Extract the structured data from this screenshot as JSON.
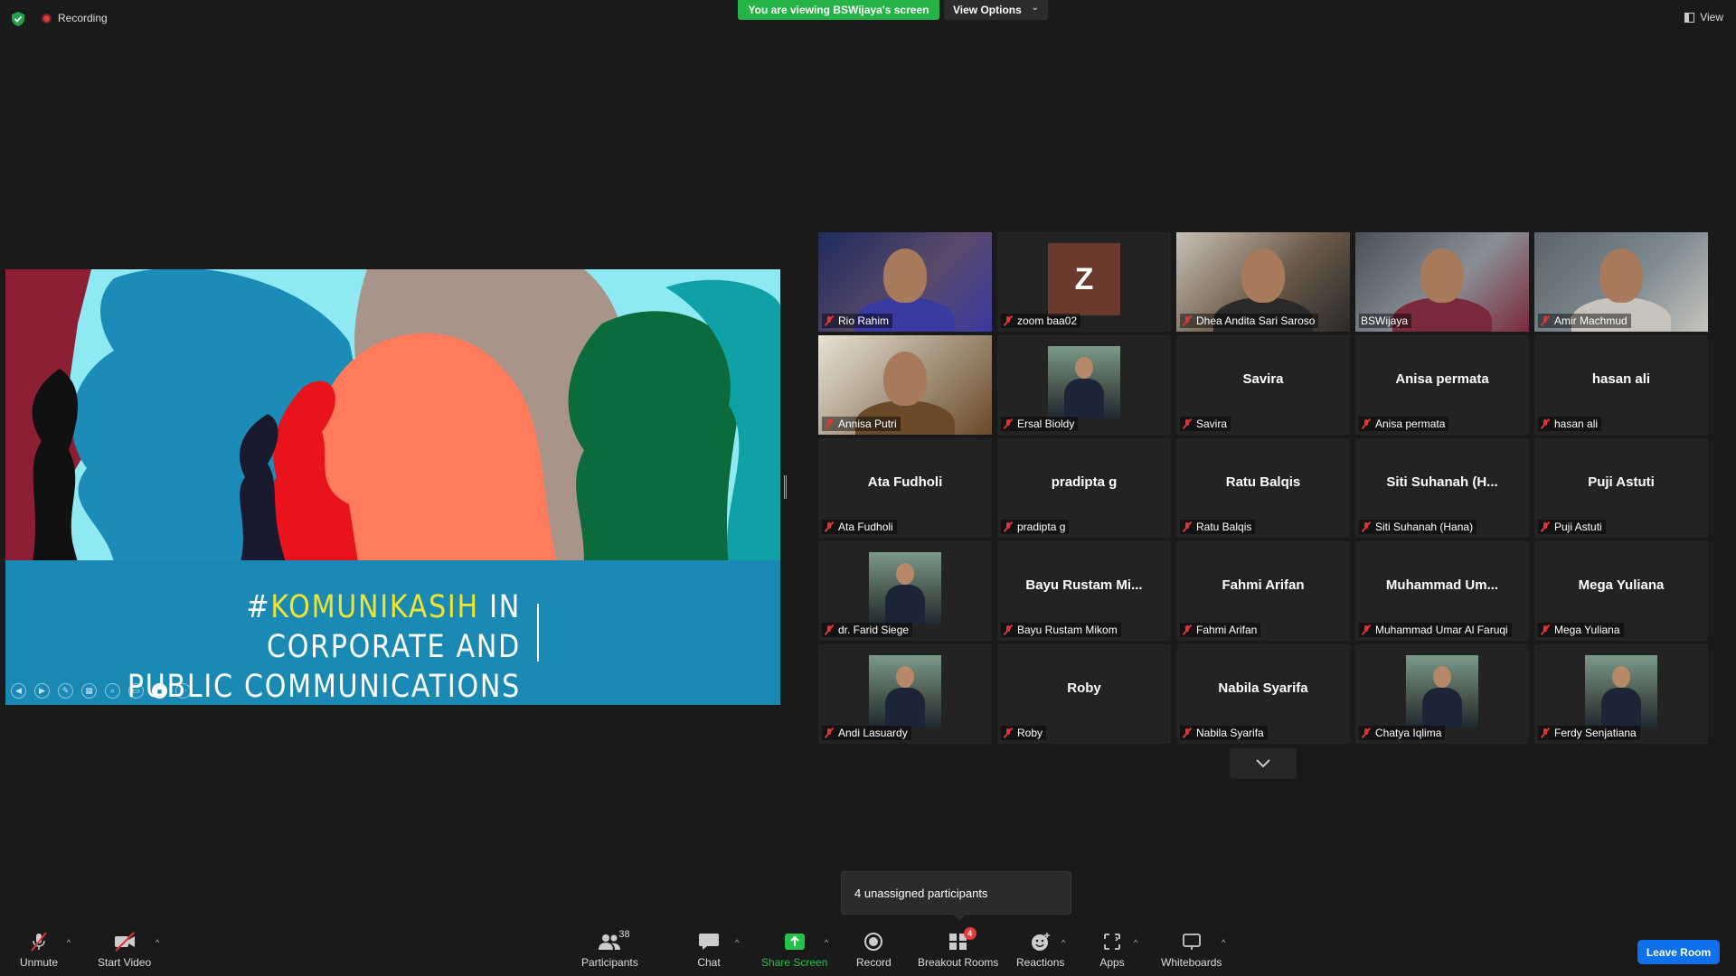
{
  "topbar": {
    "recording_label": "Recording",
    "viewing_banner": "You are viewing BSWijaya's screen",
    "view_options_label": "View Options",
    "view_label": "View"
  },
  "slide": {
    "title_hash": "#",
    "title_highlight": "KOMUNIKASIH",
    "title_rest_line1": " IN CORPORATE AND",
    "title_line2": "PUBLIC COMMUNICATIONS",
    "colors": {
      "sky": "#8fe9f2",
      "band": "#1a8ab5",
      "highlight": "#f0e433"
    }
  },
  "participants": [
    {
      "name": "Rio Rahim",
      "type": "video"
    },
    {
      "name": "zoom baa02",
      "type": "letter",
      "letter": "Z"
    },
    {
      "name": "Dhea Andita Sari Saroso",
      "type": "video",
      "speaking": true
    },
    {
      "name": "BSWijaya",
      "type": "video"
    },
    {
      "name": "Amir Machmud",
      "type": "video"
    },
    {
      "name": "Annisa Putri",
      "type": "video"
    },
    {
      "name": "Ersal Bioldy",
      "type": "photo"
    },
    {
      "name": "Savira",
      "type": "text",
      "display": "Savira"
    },
    {
      "name": "Anisa permata",
      "type": "text",
      "display": "Anisa permata"
    },
    {
      "name": "hasan ali",
      "type": "text",
      "display": "hasan ali"
    },
    {
      "name": "Ata Fudholi",
      "type": "text",
      "display": "Ata Fudholi"
    },
    {
      "name": "pradipta g",
      "type": "text",
      "display": "pradipta g"
    },
    {
      "name": "Ratu Balqis",
      "type": "text",
      "display": "Ratu Balqis"
    },
    {
      "name": "Siti Suhanah (Hana)",
      "type": "text",
      "display": "Siti  Suhanah  (H..."
    },
    {
      "name": "Puji Astuti",
      "type": "text",
      "display": "Puji Astuti"
    },
    {
      "name": "dr. Farid Siege",
      "type": "photo"
    },
    {
      "name": "Bayu Rustam Mikom",
      "type": "text",
      "display": "Bayu  Rustam  Mi..."
    },
    {
      "name": "Fahmi Arifan",
      "type": "text",
      "display": "Fahmi Arifan"
    },
    {
      "name": "Muhammad Umar Al Faruqi",
      "type": "text",
      "display": "Muhammad  Um..."
    },
    {
      "name": "Mega Yuliana",
      "type": "text",
      "display": "Mega Yuliana"
    },
    {
      "name": "Andi Lasuardy",
      "type": "photo"
    },
    {
      "name": "Roby",
      "type": "text",
      "display": "Roby"
    },
    {
      "name": "Nabila Syarifa",
      "type": "text",
      "display": "Nabila Syarifa"
    },
    {
      "name": "Chatya Iqlima",
      "type": "photo"
    },
    {
      "name": "Ferdy Senjatiana",
      "type": "photo"
    }
  ],
  "tooltip": {
    "text": "4 unassigned participants"
  },
  "toolbar": {
    "unmute": "Unmute",
    "start_video": "Start Video",
    "participants": "Participants",
    "participants_count": "38",
    "chat": "Chat",
    "share_screen": "Share Screen",
    "record": "Record",
    "breakout_rooms": "Breakout Rooms",
    "breakout_badge": "4",
    "reactions": "Reactions",
    "apps": "Apps",
    "whiteboards": "Whiteboards",
    "leave": "Leave Room"
  }
}
